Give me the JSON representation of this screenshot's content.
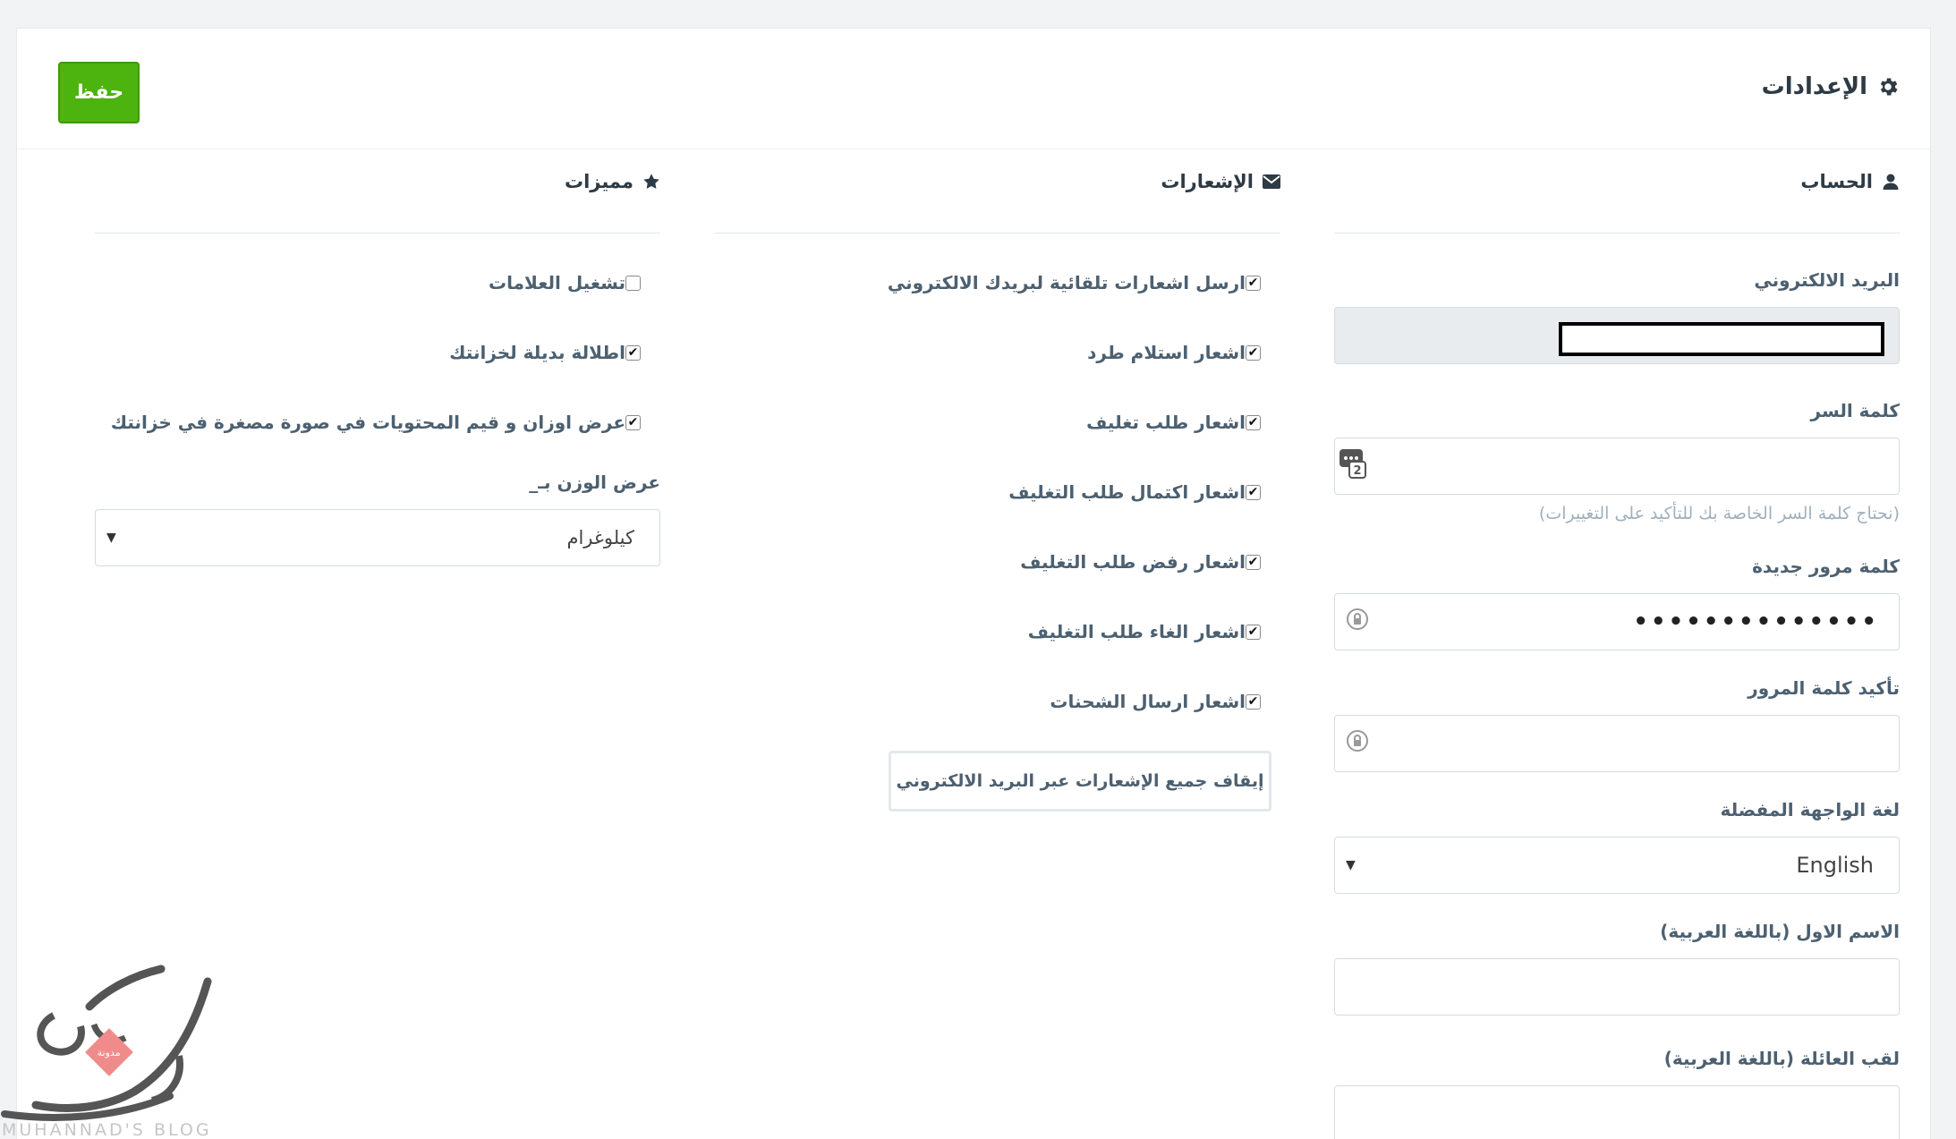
{
  "header": {
    "title": "الإعدادات",
    "save_label": "حفظ"
  },
  "account": {
    "heading": "الحساب",
    "email_label": "البريد الالكتروني",
    "email_value": "",
    "password_label": "كلمة السر",
    "password_hint": "(نحتاج كلمة السر الخاصة بك للتأكيد على التغييرات)",
    "new_password_label": "كلمة مرور جديدة",
    "new_password_value": "••••••••••••••",
    "confirm_password_label": "تأكيد كلمة المرور",
    "language_label": "لغة الواجهة المفضلة",
    "language_value": "English",
    "first_name_label": "الاسم الاول (باللغة العربية)",
    "last_name_label": "لقب العائلة (باللغة العربية)"
  },
  "notifications": {
    "heading": "الإشعارات",
    "items": [
      {
        "label": "ارسل اشعارات تلقائية لبريدك الالكتروني",
        "checked": true
      },
      {
        "label": "اشعار استلام طرد",
        "checked": true
      },
      {
        "label": "اشعار طلب تغليف",
        "checked": true
      },
      {
        "label": "اشعار اكتمال طلب التغليف",
        "checked": true
      },
      {
        "label": "اشعار رفض طلب التغليف",
        "checked": true
      },
      {
        "label": "اشعار الغاء طلب التغليف",
        "checked": true
      },
      {
        "label": "اشعار ارسال الشحنات",
        "checked": true
      }
    ],
    "stop_all_label": "إيقاف جميع الإشعارات عبر البريد الالكتروني"
  },
  "features": {
    "heading": "مميزات",
    "items": [
      {
        "label": "تشغيل العلامات",
        "checked": false
      },
      {
        "label": "اطلالة بديلة لخزانتك",
        "checked": true
      },
      {
        "label": "عرض اوزان و قيم المحتويات في صورة مصغرة في خزانتك",
        "checked": true
      }
    ],
    "weight_label": "عرض الوزن بـ_",
    "weight_value": "كيلوغرام"
  },
  "watermark": {
    "text": "MUHANNAD'S BLOG",
    "badge": "مدونة"
  },
  "colors": {
    "save_green": "#4cb30f",
    "accent_text": "#4c6070"
  }
}
